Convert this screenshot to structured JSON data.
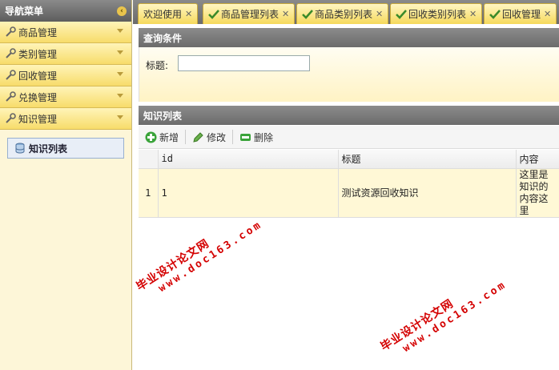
{
  "sidebar": {
    "title": "导航菜单",
    "collapse_icon": "collapse-icon",
    "items": [
      {
        "label": "商品管理"
      },
      {
        "label": "类别管理"
      },
      {
        "label": "回收管理"
      },
      {
        "label": "兑换管理"
      },
      {
        "label": "知识管理"
      }
    ],
    "submenu": [
      {
        "label": "知识列表"
      }
    ]
  },
  "tabs": [
    {
      "label": "欢迎使用"
    },
    {
      "label": "商品管理列表"
    },
    {
      "label": "商品类别列表"
    },
    {
      "label": "回收类别列表"
    },
    {
      "label": "回收管理"
    }
  ],
  "query": {
    "title": "查询条件",
    "field_label": "标题:",
    "field_value": ""
  },
  "list": {
    "title": "知识列表",
    "toolbar": {
      "add_label": "新增",
      "edit_label": "修改",
      "delete_label": "删除"
    },
    "columns": [
      "id",
      "标题",
      "内容"
    ],
    "rows": [
      {
        "rownum": "1",
        "id": "1",
        "title": "测试资源回收知识",
        "content": "这里是知识的内容这里"
      }
    ]
  },
  "watermarks": [
    {
      "text": "毕业设计论文网",
      "url": "www.doc163.com"
    },
    {
      "text": "毕业设计论文网",
      "url": "www.doc163.com"
    }
  ],
  "colors": {
    "accent": "#f7dc6a",
    "header_gray": "#6b6b6b",
    "watermark": "#d40000"
  }
}
